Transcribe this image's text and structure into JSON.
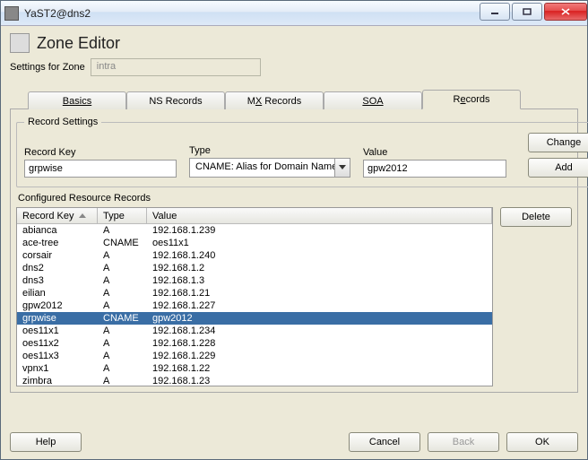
{
  "window": {
    "title": "YaST2@dns2"
  },
  "header": {
    "title": "Zone Editor"
  },
  "settings": {
    "label": "Settings for Zone",
    "value": "intra"
  },
  "tabs": {
    "basics": "Basics",
    "ns": "NS Records",
    "mx": "MX Records",
    "soa": "SOA",
    "records": "Records"
  },
  "record_settings": {
    "legend": "Record Settings",
    "key_label": "Record Key",
    "key_value": "grpwise",
    "type_label": "Type",
    "type_value": "CNAME: Alias for Domain Name",
    "value_label": "Value",
    "value_value": "gpw2012",
    "change_btn": "Change",
    "add_btn": "Add"
  },
  "configured": {
    "label": "Configured Resource Records",
    "col_key": "Record Key",
    "col_type": "Type",
    "col_value": "Value",
    "delete_btn": "Delete",
    "rows": [
      {
        "key": "abianca",
        "type": "A",
        "value": "192.168.1.239",
        "sel": false
      },
      {
        "key": "ace-tree",
        "type": "CNAME",
        "value": "oes11x1",
        "sel": false
      },
      {
        "key": "corsair",
        "type": "A",
        "value": "192.168.1.240",
        "sel": false
      },
      {
        "key": "dns2",
        "type": "A",
        "value": "192.168.1.2",
        "sel": false
      },
      {
        "key": "dns3",
        "type": "A",
        "value": "192.168.1.3",
        "sel": false
      },
      {
        "key": "eilian",
        "type": "A",
        "value": "192.168.1.21",
        "sel": false
      },
      {
        "key": "gpw2012",
        "type": "A",
        "value": "192.168.1.227",
        "sel": false
      },
      {
        "key": "grpwise",
        "type": "CNAME",
        "value": "gpw2012",
        "sel": true
      },
      {
        "key": "oes11x1",
        "type": "A",
        "value": "192.168.1.234",
        "sel": false
      },
      {
        "key": "oes11x2",
        "type": "A",
        "value": "192.168.1.228",
        "sel": false
      },
      {
        "key": "oes11x3",
        "type": "A",
        "value": "192.168.1.229",
        "sel": false
      },
      {
        "key": "vpnx1",
        "type": "A",
        "value": "192.168.1.22",
        "sel": false
      },
      {
        "key": "zimbra",
        "type": "A",
        "value": "192.168.1.23",
        "sel": false
      }
    ]
  },
  "bottom": {
    "help": "Help",
    "cancel": "Cancel",
    "back": "Back",
    "ok": "OK"
  }
}
